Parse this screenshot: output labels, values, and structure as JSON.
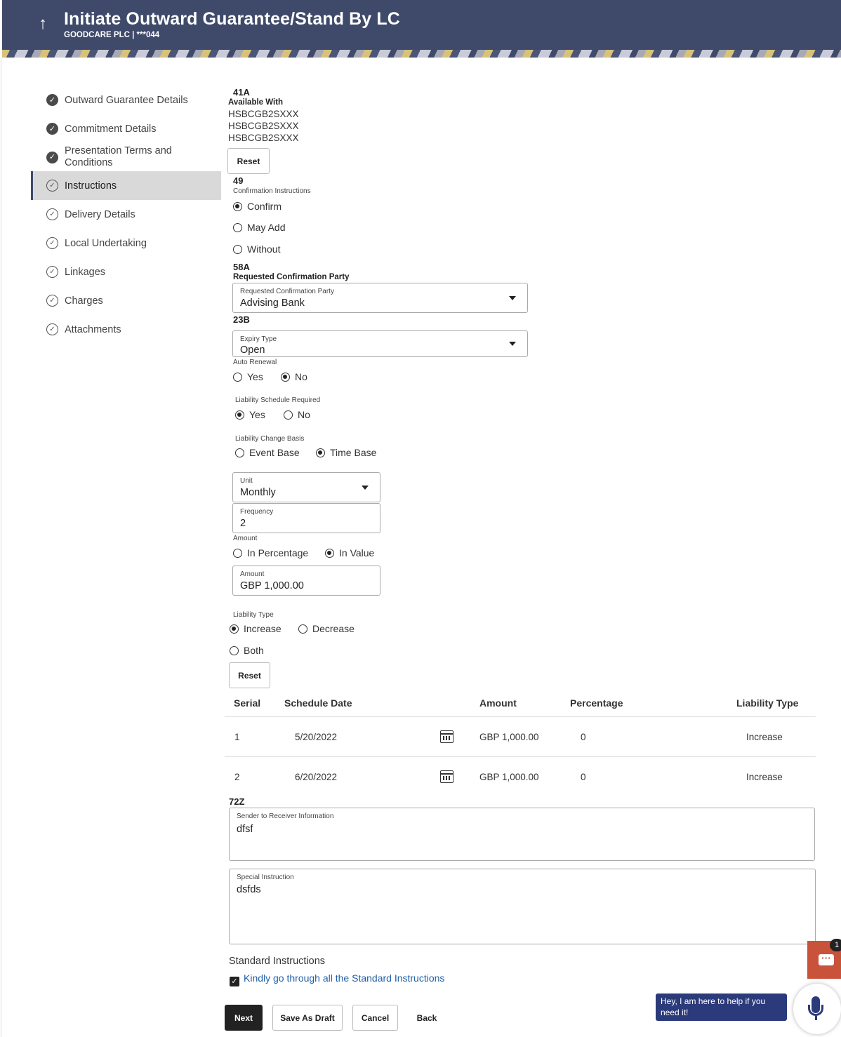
{
  "header": {
    "title": "Initiate Outward Guarantee/Stand By LC",
    "subtitle": "GOODCARE PLC | ***044",
    "back_icon": "↑"
  },
  "steps": [
    {
      "label": "Outward Guarantee Details",
      "state": "done"
    },
    {
      "label": "Commitment Details",
      "state": "done"
    },
    {
      "label": "Presentation Terms and Conditions",
      "state": "done"
    },
    {
      "label": "Instructions",
      "state": "active"
    },
    {
      "label": "Delivery Details",
      "state": "todo"
    },
    {
      "label": "Local Undertaking",
      "state": "todo"
    },
    {
      "label": "Linkages",
      "state": "todo"
    },
    {
      "label": "Charges",
      "state": "todo"
    },
    {
      "label": "Attachments",
      "state": "todo"
    }
  ],
  "available_with": {
    "tag": "41A",
    "label": "Available With",
    "lines": [
      "HSBCGB2SXXX",
      "HSBCGB2SXXX",
      "HSBCGB2SXXX"
    ],
    "reset_label": "Reset"
  },
  "confirmation": {
    "tag": "49",
    "label": "Confirmation Instructions",
    "options": [
      "Confirm",
      "May Add",
      "Without"
    ],
    "selected": "Confirm"
  },
  "confirmation_party": {
    "tag": "58A",
    "label": "Requested Confirmation Party",
    "field_label": "Requested Confirmation Party",
    "value": "Advising Bank"
  },
  "expiry": {
    "tag": "23B",
    "field_label": "Expiry Type",
    "value": "Open",
    "auto_renewal_label": "Auto Renewal",
    "auto_renewal_yes": "Yes",
    "auto_renewal_no": "No",
    "auto_renewal_selected": "No"
  },
  "liability_schedule": {
    "label": "Liability Schedule Required",
    "yes": "Yes",
    "no": "No",
    "selected": "Yes"
  },
  "liability_change": {
    "label": "Liability Change Basis",
    "event": "Event Base",
    "time": "Time Base",
    "selected": "Time Base"
  },
  "unit": {
    "label": "Unit",
    "value": "Monthly"
  },
  "frequency": {
    "label": "Frequency",
    "value": "2"
  },
  "amount_mode": {
    "label": "Amount",
    "percentage": "In Percentage",
    "value": "In Value",
    "selected": "In Value"
  },
  "amount_field": {
    "label": "Amount",
    "value": "GBP 1,000.00"
  },
  "liability_type": {
    "label": "Liability Type",
    "increase": "Increase",
    "decrease": "Decrease",
    "both": "Both",
    "selected": "Increase",
    "reset_label": "Reset"
  },
  "schedule_table": {
    "headers": [
      "Serial",
      "Schedule Date",
      "Amount",
      "Percentage",
      "Liability Type"
    ],
    "rows": [
      {
        "serial": "1",
        "date": "5/20/2022",
        "amount": "GBP 1,000.00",
        "percentage": "0",
        "type": "Increase"
      },
      {
        "serial": "2",
        "date": "6/20/2022",
        "amount": "GBP 1,000.00",
        "percentage": "0",
        "type": "Increase"
      }
    ]
  },
  "sender_info": {
    "tag": "72Z",
    "label": "Sender to Receiver Information",
    "value": "dfsf"
  },
  "special_instruction": {
    "label": "Special Instruction",
    "value": "dsfds"
  },
  "standard_instructions": {
    "label": "Standard Instructions",
    "link": "Kindly go through all the Standard Instructions",
    "checked": true
  },
  "actions": {
    "next": "Next",
    "save_draft": "Save As Draft",
    "cancel": "Cancel",
    "back": "Back"
  },
  "chat": {
    "badge": "1",
    "tooltip": "Hey, I am here to help if you need it!"
  },
  "colors": {
    "header_bg": "#3f4a6b",
    "link": "#1f5fa8",
    "chat_bg": "#c8523a",
    "assistant": "#2b3a7a"
  }
}
